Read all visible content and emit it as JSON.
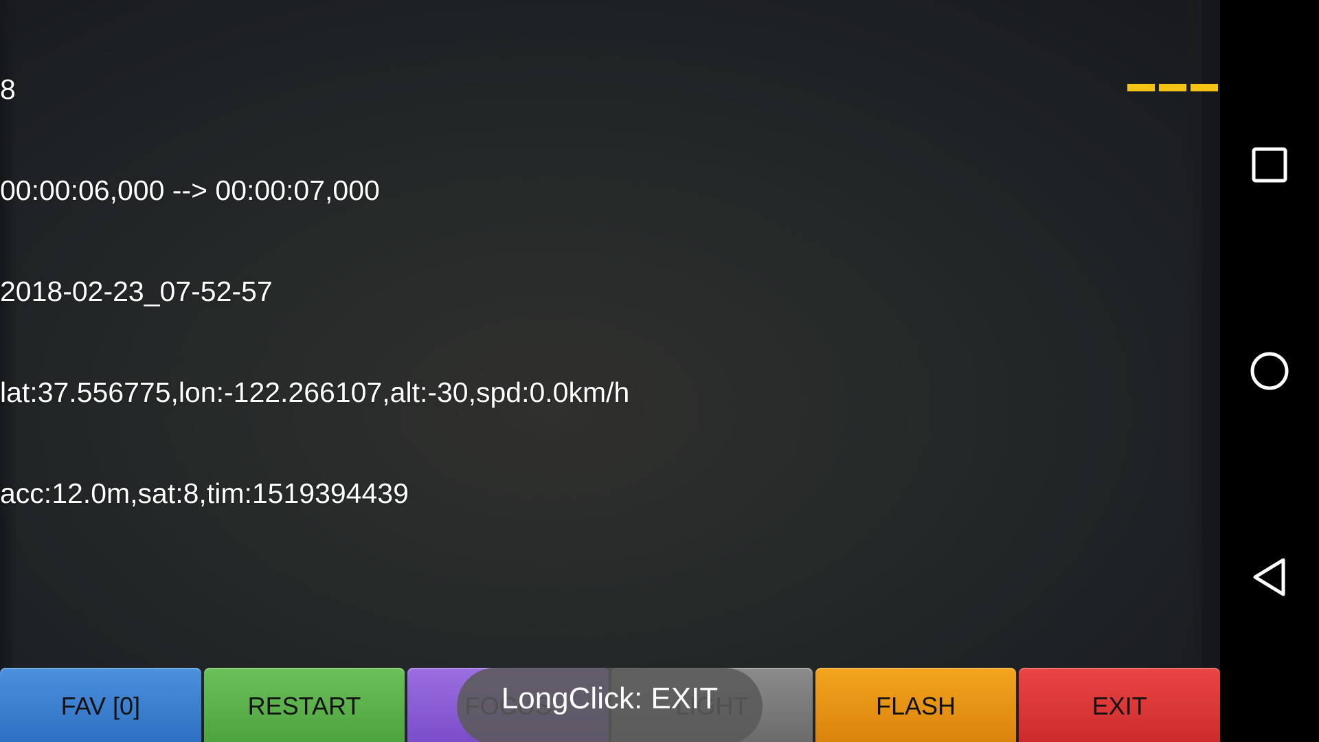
{
  "overlay": {
    "lines": [
      "8",
      "00:00:06,000 --> 00:00:07,000",
      "2018-02-23_07-52-57",
      "lat:37.556775,lon:-122.266107,alt:-30,spd:0.0km/h",
      "acc:12.0m,sat:8,tim:1519394439"
    ]
  },
  "level_indicator": {
    "color": "#f3c316",
    "segments": 3
  },
  "buttons": {
    "fav": "FAV [0]",
    "restart": "RESTART",
    "focus": "FOCUS",
    "light": "LIGHT",
    "flash": "FLASH",
    "exit": "EXIT"
  },
  "button_colors": {
    "fav": "#3a7fd0",
    "restart": "#5cb24a",
    "focus": "#8a5cd6",
    "light": "#7a7a7a",
    "flash": "#e8950f",
    "exit": "#de3636"
  },
  "toast": {
    "text": "LongClick: EXIT"
  },
  "navbar": {
    "icons": [
      "recents-square-icon",
      "home-circle-icon",
      "back-triangle-icon"
    ]
  }
}
